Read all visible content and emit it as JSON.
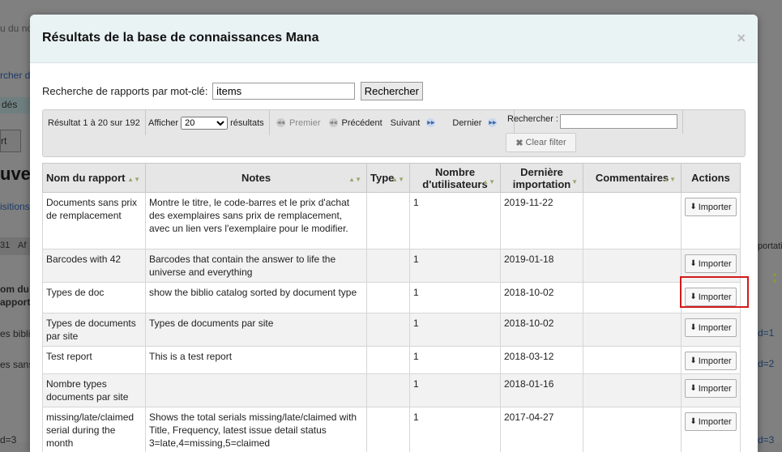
{
  "modal": {
    "title": "Résultats de la base de connaissances Mana",
    "close": "×"
  },
  "search": {
    "label": "Recherche de rapports par mot-clé:",
    "value": "items",
    "button": "Rechercher"
  },
  "pager": {
    "info": "Résultat 1 à 20 sur 192",
    "show_label": "Afficher",
    "show_value": "20",
    "show_suffix": "résultats",
    "first": "Premier",
    "previous": "Précédent",
    "next": "Suivant",
    "last": "Dernier",
    "filter_label": "Rechercher :",
    "filter_value": "",
    "clear_filter": "Clear filter"
  },
  "table": {
    "headers": {
      "name": "Nom du rapport",
      "notes": "Notes",
      "type": "Type",
      "users_1": "Nombre",
      "users_2": "d'utilisateurs",
      "last_1": "Dernière",
      "last_2": "importation",
      "comments": "Commentaires",
      "actions": "Actions"
    },
    "import_label": "Importer",
    "rows": [
      {
        "name": "Documents sans prix de remplacement",
        "notes": "Montre le titre, le code-barres et le prix d'achat des exemplaires sans prix de remplacement, avec un lien vers l'exemplaire pour le modifier.",
        "type": "",
        "users": "1",
        "date": "2019-11-22",
        "comments": ""
      },
      {
        "name": "Barcodes with 42",
        "notes": "Barcodes that contain the answer to life the universe and everything",
        "type": "",
        "users": "1",
        "date": "2019-01-18",
        "comments": ""
      },
      {
        "name": "Types de doc",
        "notes": "show the biblio catalog sorted by document type",
        "type": "",
        "users": "1",
        "date": "2018-10-02",
        "comments": ""
      },
      {
        "name": "Types de documents par site",
        "notes": "Types de documents par site",
        "type": "",
        "users": "1",
        "date": "2018-10-02",
        "comments": ""
      },
      {
        "name": "Test report",
        "notes": "This is a test report",
        "type": "",
        "users": "1",
        "date": "2018-03-12",
        "comments": ""
      },
      {
        "name": "Nombre types documents par site",
        "notes": "",
        "type": "",
        "users": "1",
        "date": "2018-01-16",
        "comments": ""
      },
      {
        "name": "missing/late/claimed serial during the month",
        "notes": "Shows the total serials missing/late/claimed with Title, Frequency, latest issue detail status 3=late,4=missing,5=claimed",
        "type": "",
        "users": "1",
        "date": "2017-04-27",
        "comments": ""
      }
    ]
  },
  "background": {
    "frag1": "u du nom",
    "frag2": "rcher d",
    "frag3": "dés",
    "frag4": "rt",
    "frag5": "uveg",
    "frag6": "isitions",
    "frag7": "31",
    "frag8": "Af",
    "frag9": "om du",
    "frag10": "apport",
    "frag11": "es bibli",
    "frag12": "es sans",
    "frag13": "d=3",
    "right1": "portatio",
    "right2": "d=1",
    "right3": "d=2",
    "right4": "d=3"
  },
  "colors": {
    "highlight": "#d21a1a",
    "header_bg": "#eaf3f3",
    "link": "#1c56a3"
  }
}
